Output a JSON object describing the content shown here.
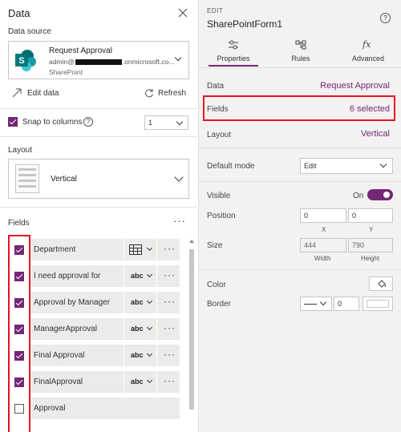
{
  "left_panel": {
    "title": "Data",
    "data_source_label": "Data source",
    "source": {
      "name": "Request Approval",
      "account_prefix": "admin@",
      "account_suffix": ".onmicrosoft.co...",
      "type": "SharePoint"
    },
    "edit_data_label": "Edit data",
    "refresh_label": "Refresh",
    "snap_label": "Snap to columns",
    "columns_value": "1",
    "layout_label": "Layout",
    "layout_value": "Vertical",
    "fields_label": "Fields",
    "more_glyph": "···",
    "fields": [
      {
        "label": "Department",
        "checked": true,
        "type": "grid"
      },
      {
        "label": "I need approval for",
        "checked": true,
        "type": "abc"
      },
      {
        "label": "Approval by Manager",
        "checked": true,
        "type": "abc"
      },
      {
        "label": "ManagerApproval",
        "checked": true,
        "type": "abc"
      },
      {
        "label": "Final Approval",
        "checked": true,
        "type": "abc"
      },
      {
        "label": "FinalApproval",
        "checked": true,
        "type": "abc"
      },
      {
        "label": "Approval",
        "checked": false,
        "type": ""
      }
    ]
  },
  "right_panel": {
    "edit_label": "EDIT",
    "form_name": "SharePointForm1",
    "tabs": [
      {
        "label": "Properties",
        "icon": "properties-icon",
        "active": true
      },
      {
        "label": "Rules",
        "icon": "rules-icon",
        "active": false
      },
      {
        "label": "Advanced",
        "icon": "fx-icon",
        "active": false
      }
    ],
    "fx_glyph": "fx",
    "data_label": "Data",
    "data_value": "Request Approval",
    "fields_label": "Fields",
    "fields_value": "6 selected",
    "layout_label": "Layout",
    "layout_value": "Vertical",
    "default_mode_label": "Default mode",
    "default_mode_value": "Edit",
    "visible_label": "Visible",
    "visible_value": "On",
    "position_label": "Position",
    "position_x": "0",
    "position_y": "0",
    "x_label": "X",
    "y_label": "Y",
    "size_label": "Size",
    "size_width": "444",
    "size_height": "790",
    "width_label": "Width",
    "height_label": "Height",
    "color_label": "Color",
    "border_label": "Border",
    "border_width": "0"
  },
  "colors": {
    "accent": "#742774",
    "highlight": "#e81123",
    "sharepoint": "#036c70"
  }
}
